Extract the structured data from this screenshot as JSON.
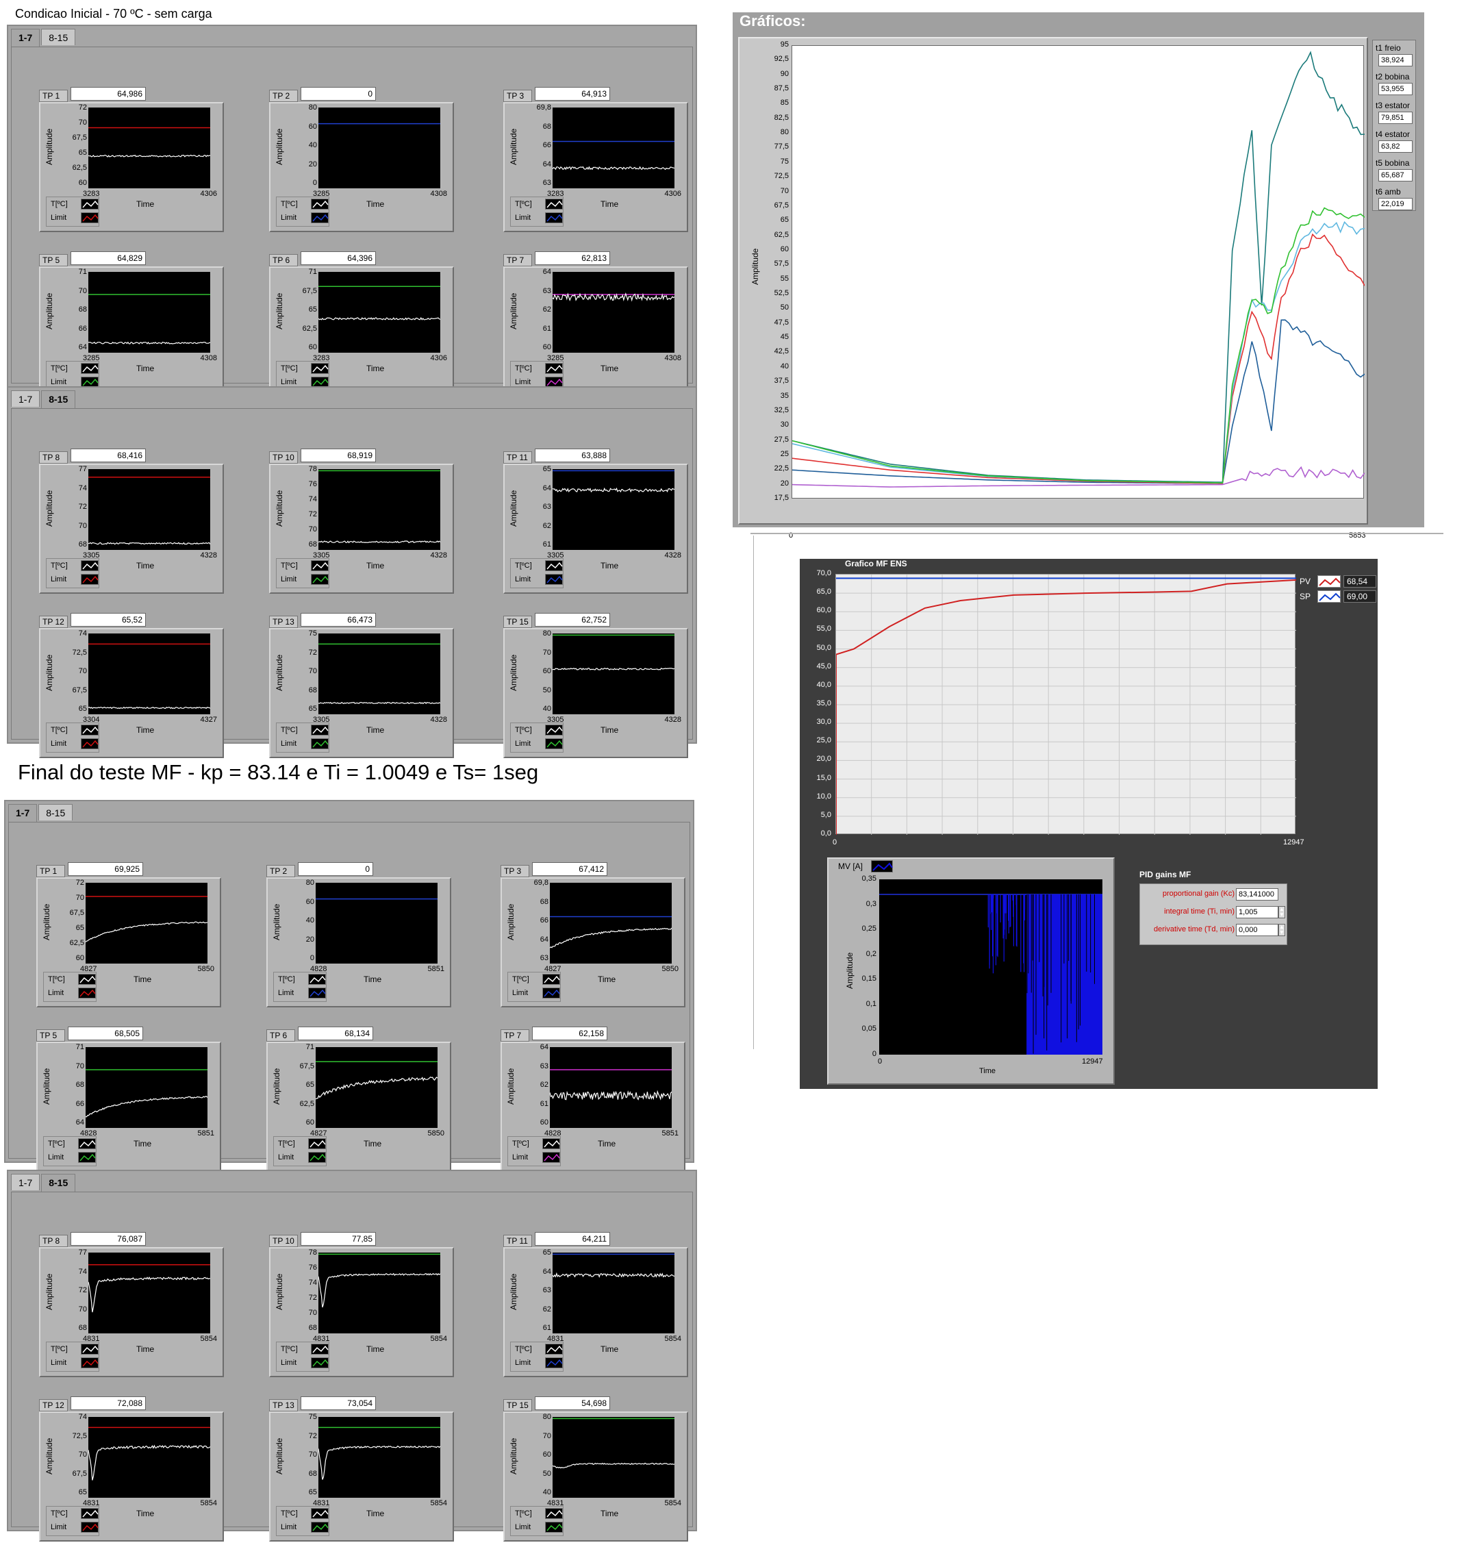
{
  "top_caption": "Condicao Inicial - 70 ºC - sem carga",
  "mid_caption": "Final do teste MF - kp = 83.14 e Ti = 1.0049 e Ts= 1seg",
  "ylabel": "Amplitude",
  "xlabel": "Time",
  "legend_temp": "T[ºC]",
  "legend_limit": "Limit",
  "tabs": [
    "1-7",
    "8-15"
  ],
  "groups": [
    {
      "active_tab": 0,
      "panels": [
        {
          "name": "TP 1",
          "value": "64,986",
          "yticks": [
            "72",
            "70",
            "67,5",
            "65",
            "62,5",
            "60"
          ],
          "xmin": "3283",
          "xmax": "4306",
          "limit_color": "#d01010",
          "limit": 0.25,
          "trace": 0.6,
          "shape": "flat",
          "noise": 0.01
        },
        {
          "name": "TP 2",
          "value": "0",
          "yticks": [
            "80",
            "60",
            "40",
            "20",
            "0"
          ],
          "xmin": "3285",
          "xmax": "4308",
          "limit_color": "#2040d0",
          "limit": 0.2,
          "trace": null,
          "shape": "flat",
          "noise": 0
        },
        {
          "name": "TP 3",
          "value": "64,913",
          "yticks": [
            "69,8",
            "68",
            "66",
            "64",
            "63"
          ],
          "xmin": "3283",
          "xmax": "4306",
          "limit_color": "#2040d0",
          "limit": 0.42,
          "trace": 0.75,
          "shape": "flat",
          "noise": 0.015
        },
        {
          "name": "TP 5",
          "value": "64,829",
          "yticks": [
            "71",
            "70",
            "68",
            "66",
            "64"
          ],
          "xmin": "3285",
          "xmax": "4308",
          "limit_color": "#30c030",
          "limit": 0.28,
          "trace": 0.88,
          "shape": "flat",
          "noise": 0.01
        },
        {
          "name": "TP 6",
          "value": "64,396",
          "yticks": [
            "71",
            "67,5",
            "65",
            "62,5",
            "60"
          ],
          "xmin": "3283",
          "xmax": "4306",
          "limit_color": "#30c030",
          "limit": 0.18,
          "trace": 0.58,
          "shape": "flat",
          "noise": 0.012
        },
        {
          "name": "TP 7",
          "value": "62,813",
          "yticks": [
            "64",
            "63",
            "62",
            "61",
            "60"
          ],
          "xmin": "3285",
          "xmax": "4308",
          "limit_color": "#d030d0",
          "limit": 0.28,
          "trace": 0.31,
          "shape": "flat",
          "noise": 0.04
        }
      ]
    },
    {
      "active_tab": 1,
      "panels": [
        {
          "name": "TP 8",
          "value": "68,416",
          "yticks": [
            "77",
            "74",
            "72",
            "70",
            "68"
          ],
          "xmin": "3305",
          "xmax": "4328",
          "limit_color": "#d01010",
          "limit": 0.1,
          "trace": 0.92,
          "shape": "flat",
          "noise": 0.01
        },
        {
          "name": "TP 10",
          "value": "68,919",
          "yticks": [
            "78",
            "76",
            "74",
            "72",
            "70",
            "68"
          ],
          "xmin": "3305",
          "xmax": "4328",
          "limit_color": "#30c030",
          "limit": 0.02,
          "trace": 0.9,
          "shape": "flat",
          "noise": 0.01
        },
        {
          "name": "TP 11",
          "value": "63,888",
          "yticks": [
            "65",
            "64",
            "63",
            "62",
            "61"
          ],
          "xmin": "3305",
          "xmax": "4328",
          "limit_color": "#2040d0",
          "limit": 0.02,
          "trace": 0.26,
          "shape": "flat",
          "noise": 0.02
        },
        {
          "name": "TP 12",
          "value": "65,52",
          "yticks": [
            "74",
            "72,5",
            "70",
            "67,5",
            "65"
          ],
          "xmin": "3304",
          "xmax": "4327",
          "limit_color": "#d01010",
          "limit": 0.13,
          "trace": 0.92,
          "shape": "flat",
          "noise": 0.008
        },
        {
          "name": "TP 13",
          "value": "66,473",
          "yticks": [
            "75",
            "72",
            "70",
            "68",
            "65"
          ],
          "xmin": "3305",
          "xmax": "4328",
          "limit_color": "#30c030",
          "limit": 0.13,
          "trace": 0.86,
          "shape": "flat",
          "noise": 0.008
        },
        {
          "name": "TP 15",
          "value": "62,752",
          "yticks": [
            "80",
            "70",
            "60",
            "50",
            "40"
          ],
          "xmin": "3305",
          "xmax": "4328",
          "limit_color": "#30c030",
          "limit": 0.02,
          "trace": 0.44,
          "shape": "flat",
          "noise": 0.01
        }
      ]
    },
    {
      "active_tab": 0,
      "panels": [
        {
          "name": "TP 1",
          "value": "69,925",
          "yticks": [
            "72",
            "70",
            "67,5",
            "65",
            "62,5",
            "60"
          ],
          "xmin": "4827",
          "xmax": "5850",
          "limit_color": "#d01010",
          "limit": 0.17,
          "trace": 0.42,
          "shape": "rise",
          "noise": 0.008
        },
        {
          "name": "TP 2",
          "value": "0",
          "yticks": [
            "80",
            "60",
            "40",
            "20",
            "0"
          ],
          "xmin": "4828",
          "xmax": "5851",
          "limit_color": "#2040d0",
          "limit": 0.2,
          "trace": null,
          "shape": "flat",
          "noise": 0
        },
        {
          "name": "TP 3",
          "value": "67,412",
          "yticks": [
            "69,8",
            "68",
            "66",
            "64",
            "63"
          ],
          "xmin": "4827",
          "xmax": "5850",
          "limit_color": "#2040d0",
          "limit": 0.42,
          "trace": 0.5,
          "shape": "rise",
          "noise": 0.01
        },
        {
          "name": "TP 5",
          "value": "68,505",
          "yticks": [
            "71",
            "70",
            "68",
            "66",
            "64"
          ],
          "xmin": "4828",
          "xmax": "5851",
          "limit_color": "#30c030",
          "limit": 0.28,
          "trace": 0.55,
          "shape": "rise",
          "noise": 0.01
        },
        {
          "name": "TP 6",
          "value": "68,134",
          "yticks": [
            "71",
            "67,5",
            "65",
            "62,5",
            "60"
          ],
          "xmin": "4827",
          "xmax": "5850",
          "limit_color": "#30c030",
          "limit": 0.18,
          "trace": 0.32,
          "shape": "rise",
          "noise": 0.02
        },
        {
          "name": "TP 7",
          "value": "62,158",
          "yticks": [
            "64",
            "63",
            "62",
            "61",
            "60"
          ],
          "xmin": "4828",
          "xmax": "5851",
          "limit_color": "#d030d0",
          "limit": 0.28,
          "trace": 0.6,
          "shape": "flat",
          "noise": 0.05
        }
      ]
    },
    {
      "active_tab": 1,
      "panels": [
        {
          "name": "TP 8",
          "value": "76,087",
          "yticks": [
            "77",
            "74",
            "72",
            "70",
            "68"
          ],
          "xmin": "4831",
          "xmax": "5854",
          "limit_color": "#d01010",
          "limit": 0.15,
          "trace": 0.4,
          "shape": "dip",
          "noise": 0.015
        },
        {
          "name": "TP 10",
          "value": "77,85",
          "yticks": [
            "78",
            "76",
            "74",
            "72",
            "70",
            "68"
          ],
          "xmin": "4831",
          "xmax": "5854",
          "limit_color": "#30c030",
          "limit": 0.02,
          "trace": 0.35,
          "shape": "dip",
          "noise": 0.01
        },
        {
          "name": "TP 11",
          "value": "64,211",
          "yticks": [
            "65",
            "64",
            "63",
            "62",
            "61"
          ],
          "xmin": "4831",
          "xmax": "5854",
          "limit_color": "#2040d0",
          "limit": 0.02,
          "trace": 0.28,
          "shape": "flat",
          "noise": 0.02
        },
        {
          "name": "TP 12",
          "value": "72,088",
          "yticks": [
            "74",
            "72,5",
            "70",
            "67,5",
            "65"
          ],
          "xmin": "4831",
          "xmax": "5854",
          "limit_color": "#d01010",
          "limit": 0.13,
          "trace": 0.45,
          "shape": "dip",
          "noise": 0.015
        },
        {
          "name": "TP 13",
          "value": "73,054",
          "yticks": [
            "75",
            "72",
            "70",
            "68",
            "65"
          ],
          "xmin": "4831",
          "xmax": "5854",
          "limit_color": "#30c030",
          "limit": 0.13,
          "trace": 0.45,
          "shape": "dip",
          "noise": 0.01
        },
        {
          "name": "TP 15",
          "value": "54,698",
          "yticks": [
            "80",
            "70",
            "60",
            "50",
            "40"
          ],
          "xmin": "4831",
          "xmax": "5854",
          "limit_color": "#30c030",
          "limit": 0.02,
          "trace": 0.6,
          "shape": "dipsmall",
          "noise": 0.008
        }
      ]
    }
  ],
  "graficos": {
    "title": "Gráficos:",
    "xmin": "0",
    "xmax": "5853",
    "ylabel": "Amplitude",
    "yticks": [
      "95",
      "92,5",
      "90",
      "87,5",
      "85",
      "82,5",
      "80",
      "77,5",
      "75",
      "72,5",
      "70",
      "67,5",
      "65",
      "62,5",
      "60",
      "57,5",
      "55",
      "52,5",
      "50",
      "47,5",
      "45",
      "42,5",
      "40",
      "37,5",
      "35",
      "32,5",
      "30",
      "27,5",
      "25",
      "22,5",
      "20",
      "17,5"
    ],
    "side": [
      {
        "label": "t1 freio",
        "value": "38,924"
      },
      {
        "label": "t2 bobina",
        "value": "53,955"
      },
      {
        "label": "t3 estator",
        "value": "79,851"
      },
      {
        "label": "t4 estator",
        "value": "63,82"
      },
      {
        "label": "t5 bobina",
        "value": "65,687"
      },
      {
        "label": "t6 amb",
        "value": "22,019"
      }
    ]
  },
  "mf": {
    "title": "Grafico MF ENS",
    "yticks": [
      "70,0",
      "65,0",
      "60,0",
      "55,0",
      "50,0",
      "45,0",
      "40,0",
      "35,0",
      "30,0",
      "25,0",
      "20,0",
      "15,0",
      "10,0",
      "5,0",
      "0,0"
    ],
    "xmin": "0",
    "xmax": "12947",
    "pv_label": "PV",
    "pv_value": "68,54",
    "sp_label": "SP",
    "sp_value": "69,00",
    "mv_label": "MV [A]",
    "mv_yticks": [
      "0,35",
      "0,3",
      "0,25",
      "0,2",
      "0,15",
      "0,1",
      "0,05",
      "0"
    ],
    "mv_xmin": "0",
    "mv_xmax": "12947",
    "mv_xlabel": "Time",
    "mv_ylabel": "Amplitude"
  },
  "pid": {
    "title": "PID gains MF",
    "kc_label": "proportional gain (Kc)",
    "kc_value": "83,141000",
    "ti_label": "integral time (Ti, min)",
    "ti_value": "1,005",
    "td_label": "derivative time (Td, min)",
    "td_value": "0,000"
  },
  "chart_data": [
    {
      "type": "line",
      "title": "Gráficos:",
      "ylabel": "Amplitude",
      "ylim": [
        17.5,
        95
      ],
      "xlim": [
        0,
        5853
      ],
      "series": [
        {
          "name": "t1 freio",
          "color": "#1f5e99",
          "x": [
            0,
            1000,
            2000,
            3000,
            4400,
            4500,
            4700,
            4900,
            5000,
            5200,
            5400,
            5853
          ],
          "values": [
            22.5,
            21.5,
            20.8,
            20.4,
            20.2,
            30,
            44,
            30,
            48,
            46,
            44,
            38.9
          ]
        },
        {
          "name": "t2 bobina",
          "color": "#e03030",
          "x": [
            0,
            1000,
            2000,
            3000,
            4400,
            4500,
            4700,
            4900,
            5000,
            5200,
            5400,
            5853
          ],
          "values": [
            24.5,
            22.5,
            21.2,
            20.6,
            20.2,
            35,
            50,
            41,
            52,
            60,
            63,
            54
          ]
        },
        {
          "name": "t3 estator",
          "color": "#1a7a7a",
          "x": [
            0,
            1000,
            2000,
            3000,
            4400,
            4500,
            4700,
            4800,
            4900,
            5100,
            5300,
            5500,
            5853
          ],
          "values": [
            27.5,
            23.5,
            21.6,
            20.8,
            20.4,
            60,
            80,
            50,
            78,
            88,
            93,
            86,
            79.9
          ]
        },
        {
          "name": "t4 estator",
          "color": "#60b8e0",
          "x": [
            0,
            1000,
            2000,
            3000,
            4400,
            4500,
            4700,
            4900,
            5000,
            5200,
            5400,
            5853
          ],
          "values": [
            27,
            23,
            21.4,
            20.7,
            20.3,
            36,
            51,
            50,
            55,
            61,
            64,
            63.8
          ]
        },
        {
          "name": "t5 bobina",
          "color": "#30c030",
          "x": [
            0,
            1000,
            2000,
            3000,
            4400,
            4500,
            4700,
            4900,
            5000,
            5200,
            5400,
            5853
          ],
          "values": [
            27.5,
            23.2,
            21.5,
            20.7,
            20.3,
            37,
            52,
            49,
            57,
            64,
            67,
            65.7
          ]
        },
        {
          "name": "t6 amb",
          "color": "#b060d0",
          "x": [
            0,
            1000,
            2000,
            3000,
            4400,
            4600,
            4800,
            5000,
            5853
          ],
          "values": [
            20,
            19.6,
            19.8,
            19.9,
            20,
            21,
            21.8,
            22,
            22
          ]
        }
      ]
    },
    {
      "type": "line",
      "title": "Grafico MF ENS",
      "ylim": [
        0,
        70
      ],
      "xlim": [
        0,
        12947
      ],
      "series": [
        {
          "name": "PV",
          "color": "#d02020",
          "x": [
            0,
            500,
            1500,
            2500,
            3500,
            5000,
            7000,
            9000,
            10000,
            11000,
            12947
          ],
          "values": [
            48.5,
            50,
            56,
            61,
            63,
            64.5,
            65,
            65.3,
            65.5,
            67.5,
            68.54
          ]
        },
        {
          "name": "SP",
          "color": "#1040d0",
          "x": [
            0,
            12947
          ],
          "values": [
            69,
            69
          ]
        }
      ]
    },
    {
      "type": "area",
      "ylabel": "Amplitude",
      "xlabel": "Time",
      "ylim": [
        0,
        0.35
      ],
      "xlim": [
        0,
        12947
      ],
      "series": [
        {
          "name": "MV [A]",
          "color": "#1010e0",
          "x": [
            0,
            6000,
            6000,
            8000,
            8000,
            9000,
            9500,
            12947
          ],
          "values": [
            0.32,
            0.32,
            0.32,
            0.32,
            0.1,
            0.32,
            0.05,
            0.32
          ]
        }
      ]
    }
  ]
}
